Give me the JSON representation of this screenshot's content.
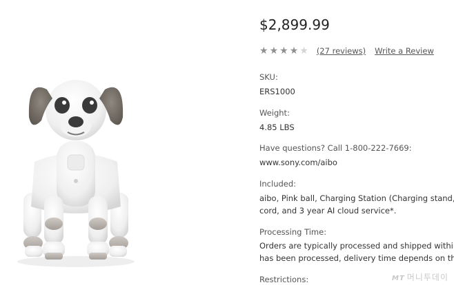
{
  "product": {
    "price": "$2,899.99",
    "rating": {
      "stars_filled": 4,
      "stars_total": 5,
      "reviews_text": "(27 reviews)",
      "write_review_text": "Write a Review"
    },
    "sku": {
      "label": "SKU:",
      "value": "ERS1000"
    },
    "weight": {
      "label": "Weight:",
      "value": "4.85 LBS"
    },
    "questions": {
      "label": "Have questions? Call 1-800-222-7669:",
      "value": "www.sony.com/aibo"
    },
    "included": {
      "label": "Included:",
      "line1": "aibo, Pink ball, Charging Station (Charging stand,",
      "line2": "cord, and 3 year AI cloud service*."
    },
    "processing": {
      "label": "Processing Time:",
      "line1": "Orders are typically processed and shipped within",
      "line2": "has been processed, delivery time depends on the"
    },
    "restrictions": {
      "label": "Restrictions:"
    }
  },
  "watermark": {
    "prefix": "MT",
    "text": "머니투데이"
  },
  "colors": {
    "star_filled": "#8f8f8f",
    "star_empty": "#d4d4d4",
    "link": "#555555"
  },
  "icons": {
    "rating_star": "star-icon",
    "product_photo": "robot-dog-aibo"
  }
}
